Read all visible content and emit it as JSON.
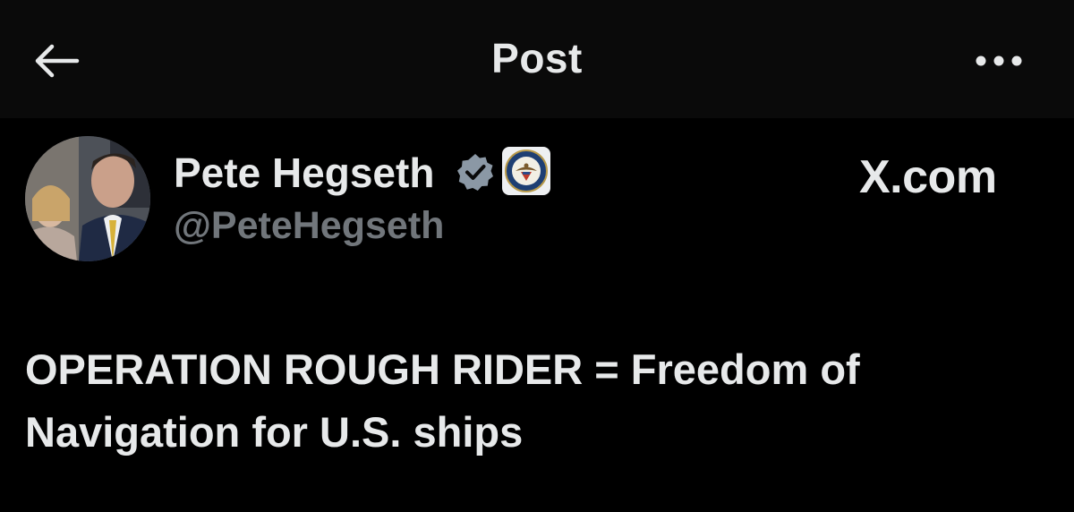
{
  "header": {
    "title": "Post",
    "back_icon": "arrow-left-icon",
    "more_icon": "more-horizontal-icon"
  },
  "author": {
    "display_name": "Pete Hegseth",
    "handle": "@PeteHegseth",
    "verified_icon": "verified-badge-icon",
    "affiliation_icon": "department-of-defense-seal-icon"
  },
  "watermark": "X.com",
  "post": {
    "text": "OPERATION ROUGH RIDER = Freedom of Navigation for U.S. ships"
  },
  "colors": {
    "background": "#000000",
    "header_background": "#0a0a0a",
    "text_primary": "#e7e9ea",
    "text_secondary": "#71767b",
    "verified_badge": "#8b98a5"
  }
}
